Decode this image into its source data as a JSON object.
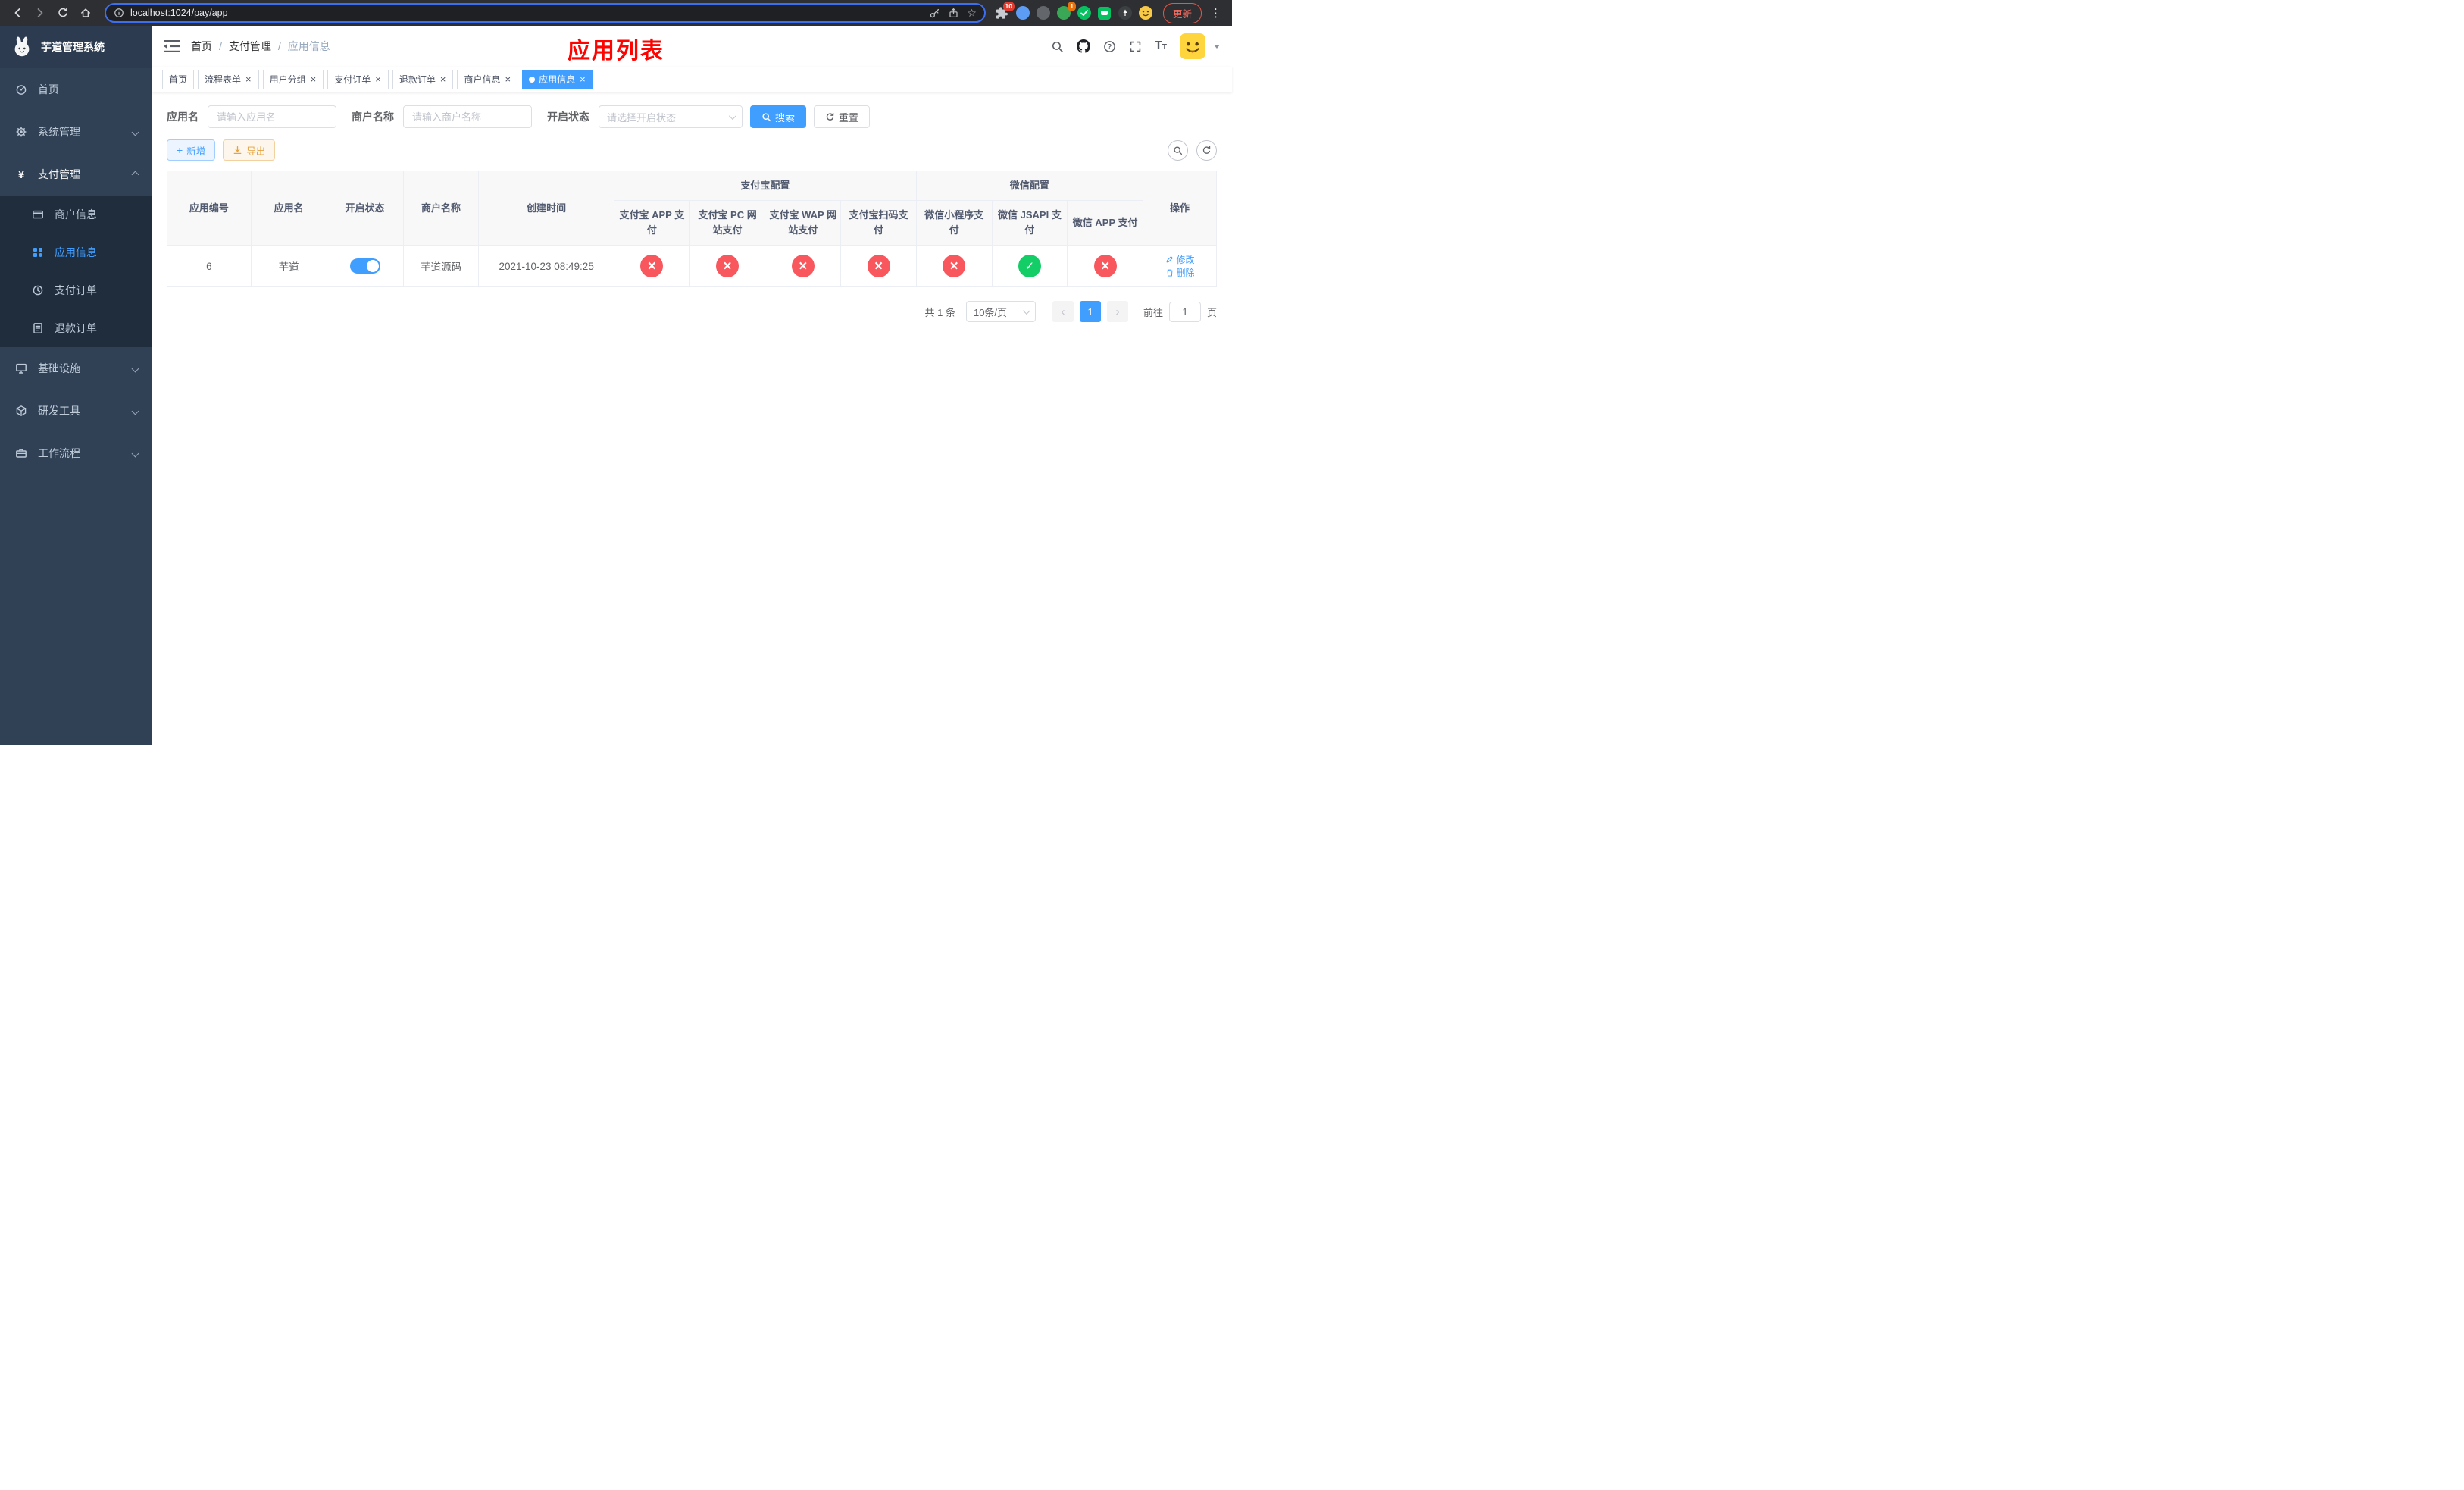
{
  "browser": {
    "url": "localhost:1024/pay/app",
    "update_label": "更新",
    "puzzle_badge": "10",
    "ext_badge": "1"
  },
  "icons": {
    "close": "×",
    "kebab": "⋮",
    "star": "☆",
    "plus": "+",
    "yen": "¥"
  },
  "sidebar": {
    "app_title": "芋道管理系统",
    "menu": [
      {
        "label": "首页"
      },
      {
        "label": "系统管理"
      },
      {
        "label": "支付管理"
      },
      {
        "label": "基础设施"
      },
      {
        "label": "研发工具"
      },
      {
        "label": "工作流程"
      }
    ],
    "submenu": [
      {
        "label": "商户信息"
      },
      {
        "label": "应用信息",
        "active": true
      },
      {
        "label": "支付订单"
      },
      {
        "label": "退款订单"
      }
    ]
  },
  "header": {
    "breadcrumb": [
      "首页",
      "支付管理",
      "应用信息"
    ],
    "separator": "/",
    "banner": "应用列表"
  },
  "tabs": [
    {
      "label": "首页",
      "closable": false,
      "active": false
    },
    {
      "label": "流程表单",
      "closable": true,
      "active": false
    },
    {
      "label": "用户分组",
      "closable": true,
      "active": false
    },
    {
      "label": "支付订单",
      "closable": true,
      "active": false
    },
    {
      "label": "退款订单",
      "closable": true,
      "active": false
    },
    {
      "label": "商户信息",
      "closable": true,
      "active": false
    },
    {
      "label": "应用信息",
      "closable": true,
      "active": true
    }
  ],
  "filters": {
    "app_name_label": "应用名",
    "app_name_placeholder": "请输入应用名",
    "merchant_label": "商户名称",
    "merchant_placeholder": "请输入商户名称",
    "status_label": "开启状态",
    "status_placeholder": "请选择开启状态",
    "search_label": "搜索",
    "reset_label": "重置"
  },
  "toolbar": {
    "add_label": "新增",
    "export_label": "导出"
  },
  "table": {
    "headers": {
      "app_id": "应用编号",
      "app_name": "应用名",
      "status": "开启状态",
      "merchant": "商户名称",
      "created": "创建时间",
      "alipay_group": "支付宝配置",
      "wechat_group": "微信配置",
      "ops": "操作",
      "config_cols": [
        "支付宝 APP 支付",
        "支付宝 PC 网站支付",
        "支付宝 WAP 网站支付",
        "支付宝扫码支付",
        "微信小程序支付",
        "微信 JSAPI 支付",
        "微信 APP 支付"
      ]
    },
    "row": {
      "app_id": "6",
      "app_name": "芋道",
      "status": "on",
      "merchant": "芋道源码",
      "created": "2021-10-23 08:49:25",
      "configs": [
        "no",
        "no",
        "no",
        "no",
        "no",
        "yes",
        "no"
      ],
      "edit_label": "修改",
      "delete_label": "删除"
    }
  },
  "pagination": {
    "total": "共 1 条",
    "page_size": "10条/页",
    "current_page": "1",
    "goto_prefix": "前往",
    "goto_value": "1",
    "goto_suffix": "页"
  },
  "colors": {
    "accent": "#409eff",
    "danger": "#f9575e",
    "success": "#13ce66",
    "banner_red": "#fe0400",
    "sidebar_bg": "#304156",
    "submenu_bg": "#1f2d3d"
  }
}
